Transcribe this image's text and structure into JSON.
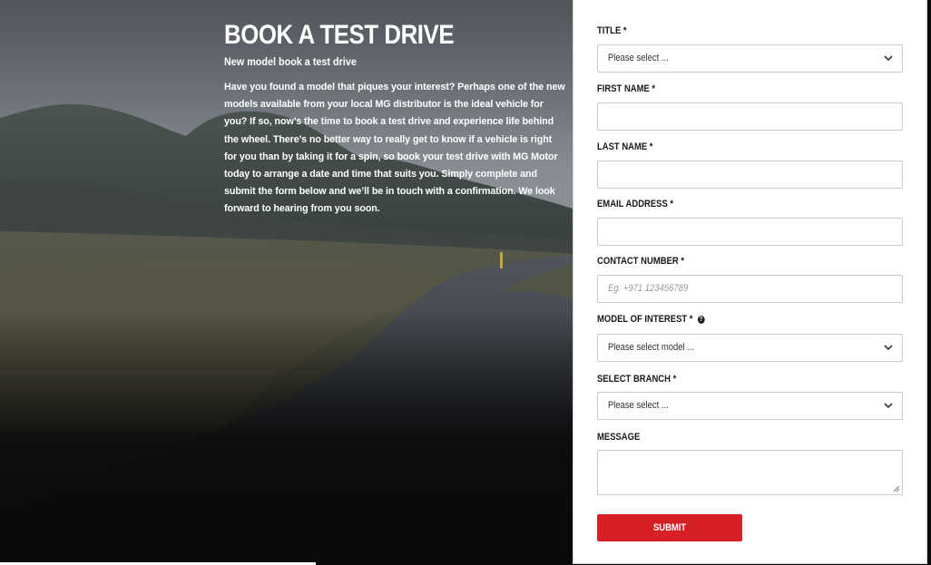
{
  "hero": {
    "title": "BOOK A TEST DRIVE",
    "subtitle": "New model book a test drive",
    "body": "Have you found a model that piques your interest? Perhaps one of the new models available from your local MG distributor is the ideal vehicle for you? If so, now’s the time to book a test drive and experience life behind the wheel. There’s no better way to really get to know if a vehicle is right for you than by taking it for a spin, so book your test drive with MG Motor today to arrange a date and time that suits you. Simply complete and submit the form below and we’ll be in touch with a confirmation. We look forward to hearing from you soon."
  },
  "form": {
    "title": {
      "label": "TITLE *",
      "selected": "Please select ..."
    },
    "first_name": {
      "label": "FIRST NAME *",
      "value": ""
    },
    "last_name": {
      "label": "LAST NAME *",
      "value": ""
    },
    "email": {
      "label": "EMAIL ADDRESS *",
      "value": ""
    },
    "contact": {
      "label": "CONTACT NUMBER *",
      "placeholder": "Eg. +971 123456789"
    },
    "model": {
      "label": "MODEL OF INTEREST *",
      "selected": "Please select model ...",
      "info_icon": "?"
    },
    "branch": {
      "label": "SELECT BRANCH *",
      "selected": "Please select ..."
    },
    "message": {
      "label": "MESSAGE",
      "value": ""
    },
    "submit_label": "SUBMIT"
  },
  "colors": {
    "accent": "#d71f26",
    "panel_bg": "#ffffff",
    "border": "#c9c9c9"
  },
  "icons": {
    "select_chevron": "chevron-down-icon",
    "model_info": "info-icon",
    "textarea_grip": "resize-grip-icon"
  }
}
